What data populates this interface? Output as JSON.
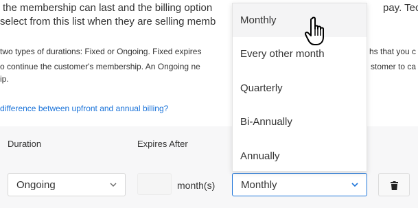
{
  "intro": {
    "line1": "the membership can last and the billing option",
    "line1_end": "pay. Techn",
    "line2": "select from this list when they are selling memb",
    "para": [
      "two types of durations: Fixed or Ongoing. Fixed expires",
      "o continue the customer's membership. An Ongoing ne",
      "ip."
    ],
    "para_right": [
      "hs that you c",
      "stomer to ca"
    ]
  },
  "link": "difference between upfront and annual billing?",
  "table": {
    "headers": {
      "duration": "Duration",
      "expires_after": "Expires After"
    },
    "row": {
      "duration": "Ongoing",
      "expires_value": "",
      "unit": "month(s)",
      "billing": "Monthly"
    }
  },
  "dropdown": {
    "options": [
      "Monthly",
      "Every other month",
      "Quarterly",
      "Bi-Annually",
      "Annually"
    ],
    "hovered": "Monthly"
  },
  "colors": {
    "link": "#1a73d9",
    "focus": "#1a73d9",
    "band": "#f7f7f8"
  },
  "icons": {
    "chevron": "chevron-down-icon",
    "trash": "trash-icon",
    "cursor": "hand-pointer-icon"
  }
}
